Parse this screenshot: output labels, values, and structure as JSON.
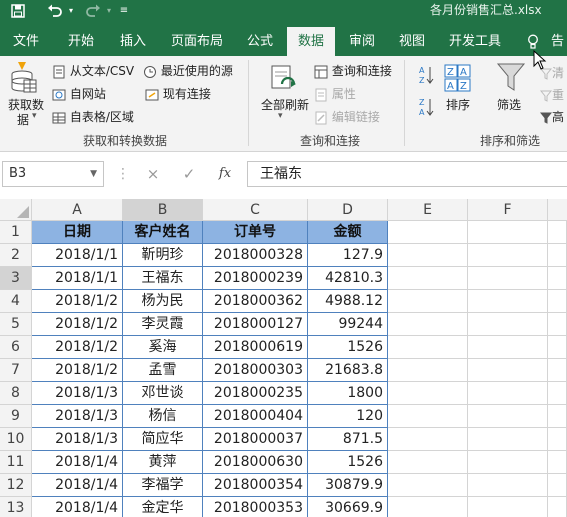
{
  "titlebar": {
    "filename": "各月份销售汇总.xlsx",
    "save_icon": "save-icon",
    "undo_icon": "undo-icon",
    "redo_icon": "redo-icon",
    "qat_customize_icon": "customize-qat-icon"
  },
  "tabs": [
    "文件",
    "开始",
    "插入",
    "页面布局",
    "公式",
    "数据",
    "审阅",
    "视图",
    "开发工具",
    "告"
  ],
  "active_tab": "数据",
  "ribbon": {
    "get_data": {
      "line1": "获取数",
      "line2": "据"
    },
    "from_text_csv": "从文本/CSV",
    "from_web": "自网站",
    "from_table": "自表格/区域",
    "recent_sources": "最近使用的源",
    "existing_connections": "现有连接",
    "group_get_transform": "获取和转换数据",
    "refresh_all": "全部刷新",
    "queries_connections": "查询和连接",
    "properties": "属性",
    "edit_links": "编辑链接",
    "group_queries": "查询和连接",
    "sort": "排序",
    "filter": "筛选",
    "clear": "清",
    "reapply": "重",
    "advanced": "高",
    "group_sort_filter": "排序和筛选"
  },
  "formula_bar": {
    "name_box": "B3",
    "cancel_icon": "×",
    "enter_icon": "✓",
    "fx_label": "fx",
    "content": "王福东"
  },
  "columns": [
    "A",
    "B",
    "C",
    "D",
    "E",
    "F"
  ],
  "selected_column": "B",
  "selected_row": "3",
  "table": {
    "headers": [
      "日期",
      "客户姓名",
      "订单号",
      "金额"
    ],
    "rows": [
      {
        "row": "2",
        "date": "2018/1/1",
        "name": "靳明珍",
        "order": "2018000328",
        "amount": "127.9"
      },
      {
        "row": "3",
        "date": "2018/1/1",
        "name": "王福东",
        "order": "2018000239",
        "amount": "42810.3"
      },
      {
        "row": "4",
        "date": "2018/1/2",
        "name": "杨为民",
        "order": "2018000362",
        "amount": "4988.12"
      },
      {
        "row": "5",
        "date": "2018/1/2",
        "name": "李灵霞",
        "order": "2018000127",
        "amount": "99244"
      },
      {
        "row": "6",
        "date": "2018/1/2",
        "name": "奚海",
        "order": "2018000619",
        "amount": "1526"
      },
      {
        "row": "7",
        "date": "2018/1/2",
        "name": "孟雪",
        "order": "2018000303",
        "amount": "21683.8"
      },
      {
        "row": "8",
        "date": "2018/1/3",
        "name": "邓世谈",
        "order": "2018000235",
        "amount": "1800"
      },
      {
        "row": "9",
        "date": "2018/1/3",
        "name": "杨信",
        "order": "2018000404",
        "amount": "120"
      },
      {
        "row": "10",
        "date": "2018/1/3",
        "name": "简应华",
        "order": "2018000037",
        "amount": "871.5"
      },
      {
        "row": "11",
        "date": "2018/1/4",
        "name": "黄萍",
        "order": "2018000630",
        "amount": "1526"
      },
      {
        "row": "12",
        "date": "2018/1/4",
        "name": "李福学",
        "order": "2018000354",
        "amount": "30879.9"
      },
      {
        "row": "13",
        "date": "2018/1/4",
        "name": "金定华",
        "order": "2018000353",
        "amount": "30669.9"
      }
    ]
  },
  "colors": {
    "excel_green": "#217346",
    "header_fill": "#8db3e2",
    "table_border": "#4f81bd"
  }
}
